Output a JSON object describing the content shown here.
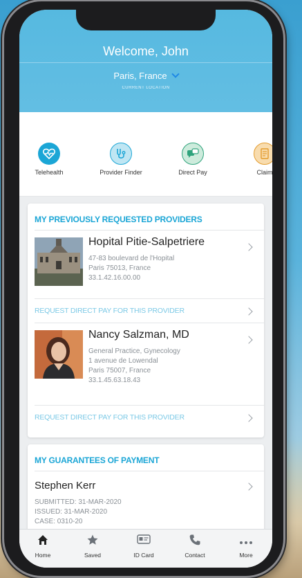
{
  "header": {
    "welcome": "Welcome, John",
    "location": "Paris, France",
    "location_caption": "CURRENT LOCATION"
  },
  "quick_actions": [
    {
      "label": "Telehealth",
      "icon": "heart-pulse-icon",
      "color": "#1ba6d6"
    },
    {
      "label": "Provider Finder",
      "icon": "stethoscope-icon",
      "color": "#1ba6d6"
    },
    {
      "label": "Direct Pay",
      "icon": "chat-bubble-icon",
      "color": "#2fa37c"
    },
    {
      "label": "Claim",
      "icon": "document-icon",
      "color": "#e39b2c"
    }
  ],
  "providers_card": {
    "title": "MY PREVIOUSLY REQUESTED PROVIDERS",
    "providers": [
      {
        "name": "Hopital Pitie-Salpetriere",
        "lines": [
          "47-83 boulevard de l'Hopital",
          "Paris 75013, France",
          "33.1.42.16.00.00"
        ],
        "image": "hospital-building-photo",
        "request_label": "REQUEST DIRECT PAY FOR THIS PROVIDER"
      },
      {
        "name": "Nancy Salzman, MD",
        "lines": [
          "General Practice, Gynecology",
          "1 avenue de Lowendal",
          "Paris 75007, France",
          "33.1.45.63.18.43"
        ],
        "image": "doctor-portrait-photo",
        "request_label": "REQUEST DIRECT PAY FOR THIS PROVIDER"
      }
    ]
  },
  "guarantees_card": {
    "title": "MY GUARANTEES OF PAYMENT",
    "items": [
      {
        "name": "Stephen Kerr",
        "lines": [
          "SUBMITTED: 31-MAR-2020",
          "ISSUED: 31-MAR-2020",
          "CASE: 0310-20"
        ]
      }
    ]
  },
  "tabbar": [
    {
      "label": "Home",
      "icon": "home-icon",
      "active": true
    },
    {
      "label": "Saved",
      "icon": "star-icon"
    },
    {
      "label": "ID Card",
      "icon": "id-card-icon"
    },
    {
      "label": "Contact",
      "icon": "phone-icon"
    },
    {
      "label": "More",
      "icon": "more-dots-icon"
    }
  ]
}
